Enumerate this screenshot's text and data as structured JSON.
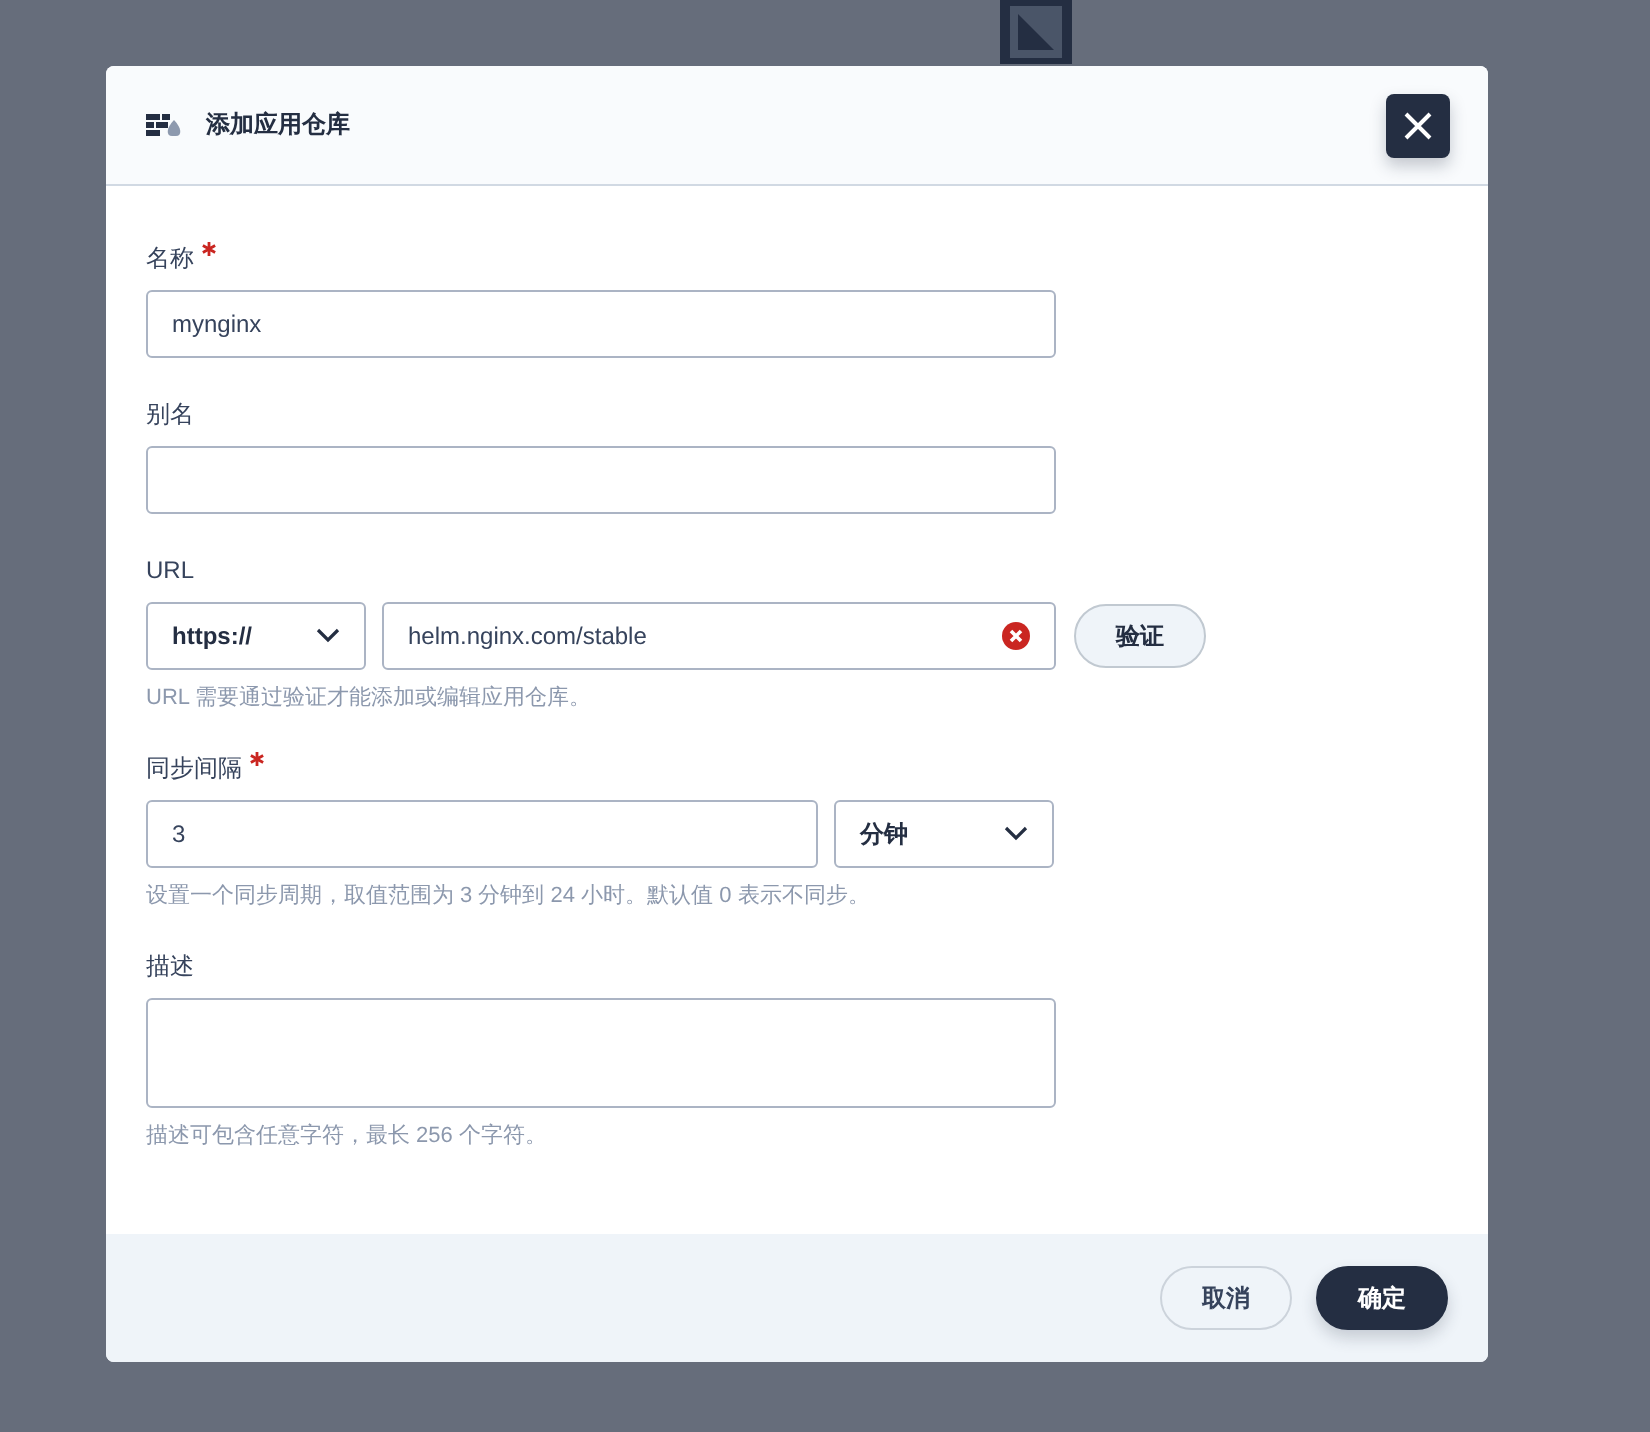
{
  "dialog": {
    "title": "添加应用仓库"
  },
  "fields": [
    {
      "kind": "text",
      "label": "名称",
      "required": true,
      "value": "mynginx"
    },
    {
      "kind": "text",
      "label": "别名",
      "required": false
    },
    {
      "kind": "url",
      "label": "URL",
      "required": false,
      "protocol": "https://",
      "value": "helm.nginx.com/stable",
      "clearable": true,
      "verify_button": "验证",
      "hint": "URL 需要通过验证才能添加或编辑应用仓库。"
    },
    {
      "kind": "interval",
      "label": "同步间隔",
      "required": true,
      "value": "3",
      "unit": "分钟",
      "hint": "设置一个同步周期，取值范围为 3 分钟到 24 小时。默认值 0 表示不同步。"
    },
    {
      "kind": "textarea",
      "label": "描述",
      "required": false,
      "hint": "描述可包含任意字符，最长 256 个字符。"
    }
  ],
  "buttons": [
    {
      "label": "取消",
      "primary": false
    },
    {
      "label": "确定",
      "primary": true
    }
  ]
}
